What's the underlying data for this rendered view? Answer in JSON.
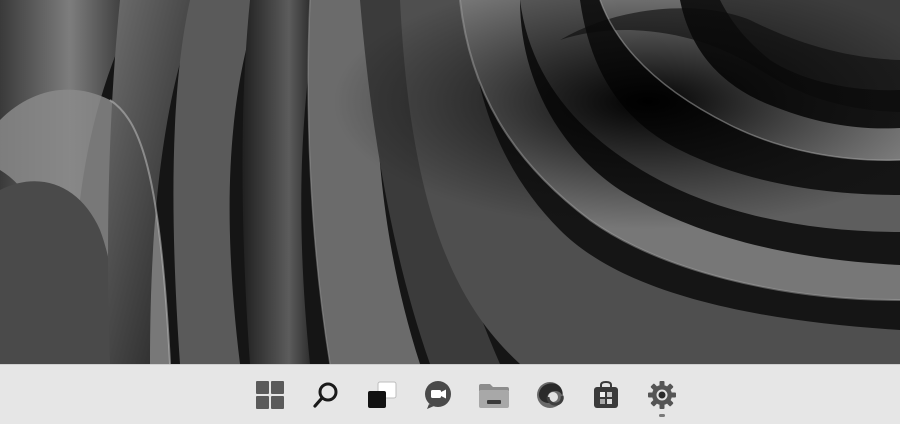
{
  "desktop": {
    "wallpaper": "abstract-dark-ribbon-wallpaper"
  },
  "taskbar": {
    "background_color": "#e6e6e6",
    "icons": [
      {
        "name": "start-icon",
        "running": false
      },
      {
        "name": "search-icon",
        "running": false
      },
      {
        "name": "task-view-icon",
        "running": false
      },
      {
        "name": "chat-icon",
        "running": false
      },
      {
        "name": "file-explorer-icon",
        "running": false
      },
      {
        "name": "edge-icon",
        "running": false
      },
      {
        "name": "store-icon",
        "running": false
      },
      {
        "name": "settings-icon",
        "running": true
      }
    ]
  }
}
